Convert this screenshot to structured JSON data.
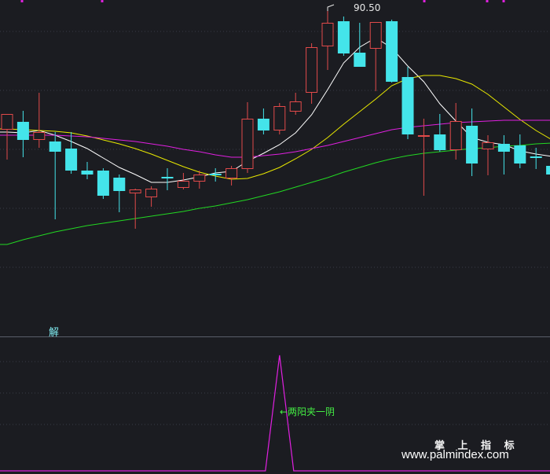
{
  "chart_data": {
    "type": "candlestick",
    "max_label": "90.50",
    "indicator_label": "解",
    "pattern_label": "←两阳夹一阴",
    "watermark_cn": "掌 上 指 标",
    "watermark_url": "www.palmindex.com",
    "ylim": [
      58,
      93
    ],
    "candles": [
      {
        "o": 76.1,
        "h": 78.1,
        "l": 72.3,
        "c": 78.1
      },
      {
        "o": 77.1,
        "h": 78.5,
        "l": 72.6,
        "c": 74.8
      },
      {
        "o": 74.8,
        "h": 80.8,
        "l": 73.8,
        "c": 75.8
      },
      {
        "o": 74.6,
        "h": 75.8,
        "l": 64.7,
        "c": 73.3
      },
      {
        "o": 73.7,
        "h": 75.8,
        "l": 70.5,
        "c": 70.9
      },
      {
        "o": 70.9,
        "h": 72.0,
        "l": 69.8,
        "c": 70.4
      },
      {
        "o": 70.9,
        "h": 71.2,
        "l": 67.3,
        "c": 67.7
      },
      {
        "o": 70.0,
        "h": 70.4,
        "l": 65.6,
        "c": 68.3
      },
      {
        "o": 68.0,
        "h": 68.6,
        "l": 63.5,
        "c": 68.5
      },
      {
        "o": 67.5,
        "h": 68.9,
        "l": 66.3,
        "c": 68.6
      },
      {
        "o": 70.1,
        "h": 71.2,
        "l": 68.4,
        "c": 69.9
      },
      {
        "o": 68.7,
        "h": 70.6,
        "l": 68.5,
        "c": 69.6
      },
      {
        "o": 69.5,
        "h": 70.9,
        "l": 68.6,
        "c": 70.4
      },
      {
        "o": 70.5,
        "h": 71.2,
        "l": 69.5,
        "c": 70.4
      },
      {
        "o": 69.9,
        "h": 71.5,
        "l": 69.0,
        "c": 71.2
      },
      {
        "o": 71.1,
        "h": 79.6,
        "l": 70.6,
        "c": 77.5
      },
      {
        "o": 77.5,
        "h": 78.8,
        "l": 75.5,
        "c": 76.0
      },
      {
        "o": 76.0,
        "h": 79.5,
        "l": 75.5,
        "c": 79.1
      },
      {
        "o": 78.4,
        "h": 80.8,
        "l": 78.0,
        "c": 79.7
      },
      {
        "o": 80.8,
        "h": 87.1,
        "l": 79.4,
        "c": 86.6
      },
      {
        "o": 86.7,
        "h": 91.2,
        "l": 83.7,
        "c": 89.7
      },
      {
        "o": 89.9,
        "h": 90.5,
        "l": 85.5,
        "c": 85.8
      },
      {
        "o": 85.9,
        "h": 89.7,
        "l": 84.6,
        "c": 84.1
      },
      {
        "o": 86.4,
        "h": 89.7,
        "l": 81.0,
        "c": 89.8
      },
      {
        "o": 89.9,
        "h": 90.1,
        "l": 82.1,
        "c": 82.2
      },
      {
        "o": 82.8,
        "h": 84.1,
        "l": 74.9,
        "c": 75.5
      },
      {
        "o": 75.3,
        "h": 77.5,
        "l": 67.7,
        "c": 75.4
      },
      {
        "o": 75.5,
        "h": 78.1,
        "l": 73.3,
        "c": 73.5
      },
      {
        "o": 73.5,
        "h": 79.5,
        "l": 72.3,
        "c": 77.2
      },
      {
        "o": 76.6,
        "h": 78.8,
        "l": 70.2,
        "c": 71.8
      },
      {
        "o": 73.6,
        "h": 75.4,
        "l": 70.3,
        "c": 74.5
      },
      {
        "o": 74.3,
        "h": 75.4,
        "l": 70.4,
        "c": 73.3
      },
      {
        "o": 74.1,
        "h": 75.5,
        "l": 71.2,
        "c": 71.8
      },
      {
        "o": 72.7,
        "h": 73.8,
        "l": 71.1,
        "c": 72.6
      },
      {
        "o": 71.5,
        "h": 73.8,
        "l": 70.2,
        "c": 70.4
      }
    ],
    "ma": [
      {
        "color": "#ffffff",
        "values": [
          75.8,
          75.7,
          76.0,
          75.4,
          74.6,
          73.7,
          72.5,
          71.3,
          70.4,
          69.4,
          69.4,
          69.7,
          70.1,
          70.6,
          70.8,
          72.1,
          73.1,
          74.2,
          75.7,
          78.0,
          81.2,
          84.6,
          86.6,
          87.8,
          86.5,
          84.2,
          82.2,
          79.4,
          77.2,
          75.1,
          74.5,
          74.2,
          73.4,
          73.0,
          72.7
        ]
      },
      {
        "color": "#e8e800",
        "values": [
          76.2,
          76.1,
          76.0,
          75.9,
          75.7,
          75.3,
          74.8,
          74.3,
          73.7,
          73.0,
          72.2,
          71.4,
          70.7,
          70.2,
          69.8,
          69.9,
          70.5,
          71.3,
          72.4,
          73.6,
          75.1,
          76.8,
          78.4,
          80.0,
          81.7,
          82.6,
          83.0,
          83.0,
          82.6,
          81.9,
          80.6,
          79.0,
          77.4,
          76.0,
          74.8
        ]
      },
      {
        "color": "#e020e0",
        "values": [
          75.4,
          75.4,
          75.4,
          75.4,
          75.3,
          75.2,
          75.0,
          74.8,
          74.6,
          74.3,
          74.0,
          73.6,
          73.3,
          72.9,
          72.6,
          72.6,
          72.8,
          73.0,
          73.3,
          73.7,
          74.1,
          74.6,
          75.1,
          75.6,
          76.1,
          76.4,
          76.6,
          76.8,
          77.0,
          77.1,
          77.2,
          77.3,
          77.3,
          77.3,
          77.3
        ]
      },
      {
        "color": "#22d822",
        "values": [
          61.5,
          62.1,
          62.6,
          63.1,
          63.5,
          63.9,
          64.2,
          64.5,
          64.8,
          65.1,
          65.4,
          65.7,
          66.1,
          66.4,
          66.8,
          67.2,
          67.7,
          68.2,
          68.8,
          69.4,
          70.0,
          70.7,
          71.3,
          71.9,
          72.4,
          72.8,
          73.1,
          73.3,
          73.5,
          73.7,
          73.8,
          74.0,
          74.1,
          74.3,
          74.4
        ]
      }
    ],
    "indicator": {
      "color": "#e020e0",
      "ylim": [
        0,
        1
      ],
      "peak_index": 17,
      "values": [
        0,
        0,
        0,
        0,
        0,
        0,
        0,
        0,
        0,
        0,
        0,
        0,
        0,
        0,
        0,
        0,
        0,
        1,
        0,
        0,
        0,
        0,
        0,
        0,
        0,
        0,
        0,
        0,
        0,
        0,
        0,
        0,
        0,
        0,
        0
      ]
    },
    "colors": {
      "up": "#e24a4a",
      "down": "#44e4ea",
      "background": "#1b1c21",
      "grid": "#3a3d48",
      "accent_top": "#dd22dd"
    }
  }
}
